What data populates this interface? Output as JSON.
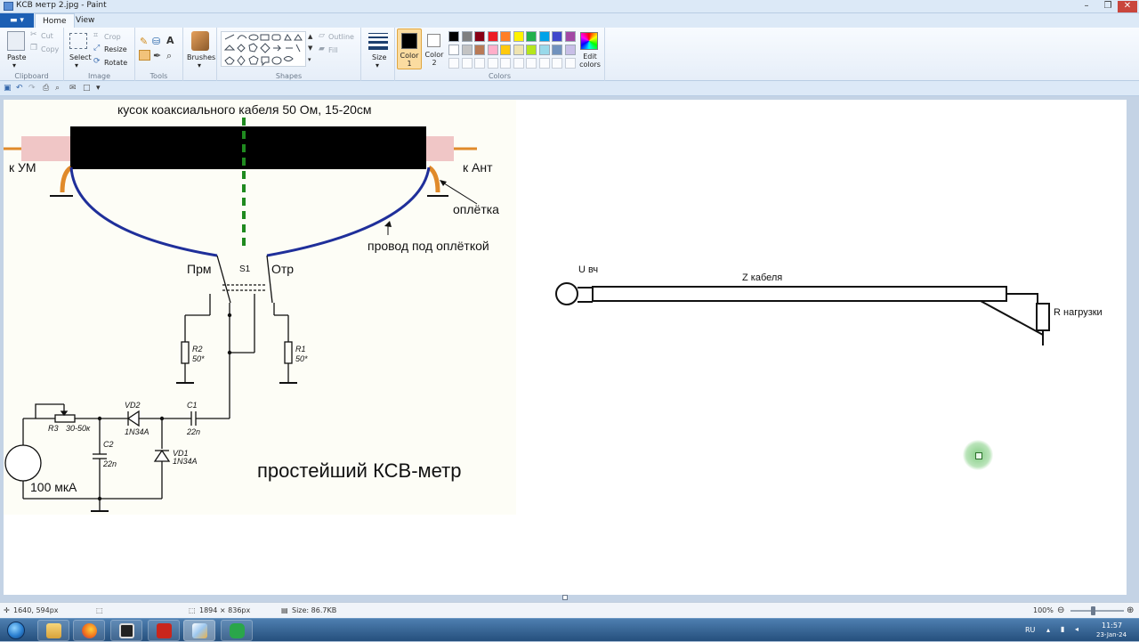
{
  "window": {
    "title": "КСВ метр 2.jpg - Paint"
  },
  "tabs": {
    "home": "Home",
    "view": "View"
  },
  "ribbon": {
    "clipboard": {
      "label": "Clipboard",
      "paste": "Paste",
      "cut": "Cut",
      "copy": "Copy"
    },
    "image": {
      "label": "Image",
      "select": "Select",
      "crop": "Crop",
      "resize": "Resize",
      "rotate": "Rotate"
    },
    "tools": {
      "label": "Tools"
    },
    "brushes": {
      "label": "Brushes"
    },
    "shapes": {
      "label": "Shapes",
      "outline": "Outline",
      "fill": "Fill"
    },
    "size": {
      "label": "Size"
    },
    "colors": {
      "label": "Colors",
      "color1": "Color\n1",
      "color2": "Color\n2",
      "edit": "Edit colors",
      "palette_row1": [
        "#000000",
        "#7f7f7f",
        "#880015",
        "#ed1c24",
        "#ff7f27",
        "#fff200",
        "#22b14c",
        "#00a2e8",
        "#3f48cc",
        "#a349a4"
      ],
      "palette_row2": [
        "#ffffff",
        "#c3c3c3",
        "#b97a57",
        "#ffaec9",
        "#ffc90e",
        "#efe4b0",
        "#b5e61d",
        "#99d9ea",
        "#7092be",
        "#c8bfe7"
      ]
    }
  },
  "diagram": {
    "cable_title": "кусок коаксиального кабеля 50 Ом, 15-20см",
    "to_amp": "к УМ",
    "to_ant": "к Ант",
    "braid": "оплётка",
    "wire_under_braid": "провод под оплёткой",
    "fwd": "Прм",
    "switch": "S1",
    "rev": "Отр",
    "r2": "R2",
    "r2_val": "50*",
    "r1": "R1",
    "r1_val": "50*",
    "vd2": "VD2",
    "vd2_type": "1N34A",
    "c1": "C1",
    "c1_val": "22n",
    "r3": "R3",
    "r3_val": "30-50к",
    "c2": "C2",
    "c2_val": "22n",
    "vd1": "VD1",
    "vd1_type": "1N34A",
    "meter": "100 мкА",
    "caption": "простейший КСВ-метр"
  },
  "sketch": {
    "u": "U вч",
    "z": "Z кабеля",
    "r": "R нагрузки"
  },
  "status": {
    "cursor": "1640, 594px",
    "dims": "1894 × 836px",
    "size": "Size: 86.7KB",
    "zoom": "100%",
    "zoom_minus": "⊖",
    "zoom_plus": "⊕"
  },
  "tray": {
    "lang": "RU",
    "time": "11:57",
    "date": "23-Jan-24"
  }
}
